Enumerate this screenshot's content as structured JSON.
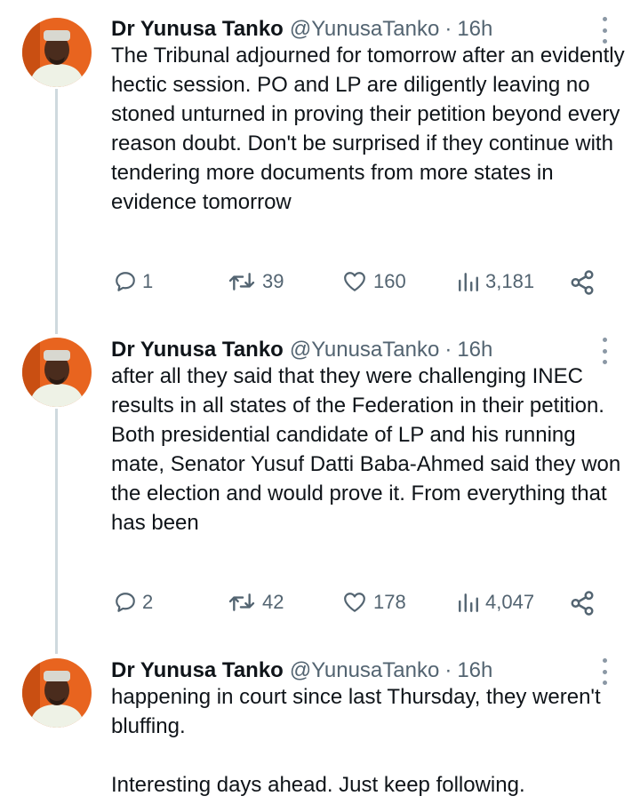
{
  "author": {
    "name": "Dr Yunusa Tanko",
    "handle": "@YunusaTanko"
  },
  "tweets": [
    {
      "time": "16h",
      "paragraphs": [
        "The Tribunal adjourned for tomorrow after an evidently hectic session. PO and LP are diligently leaving no stoned unturned in proving their petition beyond every reason doubt. Don't be surprised if they continue with tendering more documents from more states in evidence tomorrow"
      ],
      "stats": {
        "replies": "1",
        "retweets": "39",
        "likes": "160",
        "views": "3,181"
      }
    },
    {
      "time": "16h",
      "paragraphs": [
        "after all they said that they were challenging INEC results in all states of the Federation in their petition.",
        "Both presidential candidate of LP and his running mate, Senator Yusuf Datti Baba-Ahmed said they won the election and would prove it. From everything that has been"
      ],
      "stats": {
        "replies": "2",
        "retweets": "42",
        "likes": "178",
        "views": "4,047"
      }
    },
    {
      "time": "16h",
      "paragraphs": [
        "happening in court since last Thursday, they weren't bluffing.",
        "",
        "Interesting days ahead. Just keep following."
      ]
    }
  ],
  "icons": {
    "reply": "reply-icon",
    "retweet": "retweet-icon",
    "like": "heart-icon",
    "views": "analytics-icon",
    "share": "share-icon",
    "more": "more-options-icon"
  },
  "colors": {
    "text": "#0f1419",
    "muted": "#536471",
    "thread_line": "#cfd9de",
    "avatar_bg": "#e8641f"
  }
}
